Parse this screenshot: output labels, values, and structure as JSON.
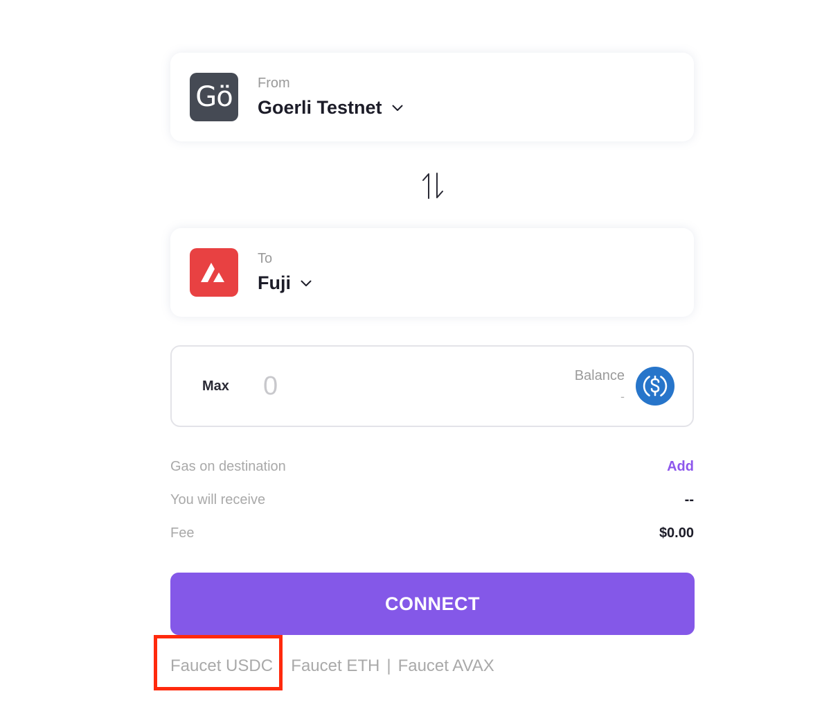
{
  "from": {
    "label": "From",
    "network_name": "Goerli Testnet",
    "logo_text": "Gö",
    "logo_color": "#454a54"
  },
  "to": {
    "label": "To",
    "network_name": "Fuji",
    "logo_color": "#e84142"
  },
  "amount": {
    "max_label": "Max",
    "placeholder": "0",
    "value": "",
    "balance_label": "Balance",
    "balance_value": "-",
    "token_icon": "usdc-icon"
  },
  "info": {
    "gas_label": "Gas on destination",
    "gas_action": "Add",
    "receive_label": "You will receive",
    "receive_value": "--",
    "fee_label": "Fee",
    "fee_value": "$0.00"
  },
  "connect_label": "CONNECT",
  "faucets": {
    "usdc": "Faucet USDC",
    "eth": "Faucet ETH",
    "avax": "Faucet AVAX",
    "separator": "|"
  },
  "colors": {
    "accent": "#8458e8",
    "link": "#8d57ec",
    "highlight": "#ff2a0d",
    "usdc": "#2775ca"
  }
}
